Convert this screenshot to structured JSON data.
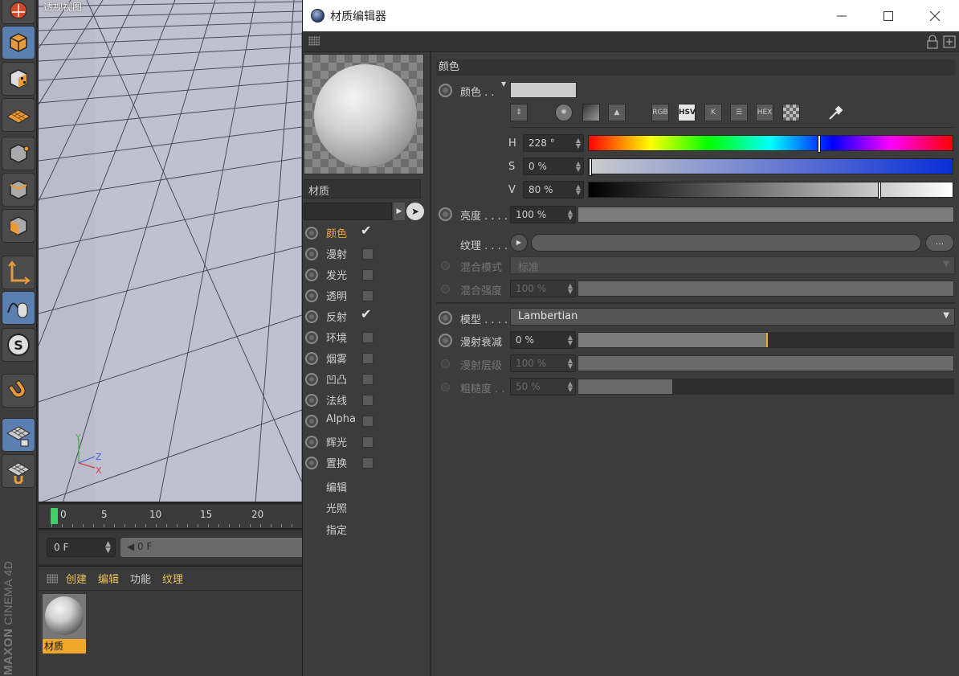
{
  "palette": {
    "tools": [
      "view-rotate-icon",
      "model-icon",
      "texture-icon",
      "workplane-icon",
      "points-icon",
      "edges-icon",
      "polygons-icon",
      "axis-icon",
      "tweak-icon",
      "soft-selection-icon",
      "snap-icon",
      "workplane-lock-icon",
      "workplane-snap-icon"
    ],
    "brand": "MAXON",
    "product": "CINEMA 4D",
    "accent": "#5b7fb0"
  },
  "viewport": {
    "title": "透视视图",
    "axes": [
      "Y",
      "Z",
      "X"
    ],
    "background_color": "#b9b8c8"
  },
  "timeline": {
    "ticks": [
      "0",
      "5",
      "10",
      "15",
      "20"
    ],
    "frame_field": "0 F",
    "slider_label": "◀ 0 F"
  },
  "material_manager": {
    "menu": [
      "创建",
      "编辑",
      "功能",
      "纹理"
    ],
    "materials": [
      {
        "name": "材质"
      }
    ],
    "selected_color": "#f0a82a"
  },
  "editor": {
    "title": "材质编辑器",
    "window_buttons": [
      "minimize",
      "maximize",
      "close"
    ],
    "material_name": "材质",
    "channels": [
      {
        "label": "颜色",
        "checked": true,
        "active": true
      },
      {
        "label": "漫射",
        "checked": false
      },
      {
        "label": "发光",
        "checked": false
      },
      {
        "label": "透明",
        "checked": false
      },
      {
        "label": "反射",
        "checked": true
      },
      {
        "label": "环境",
        "checked": false
      },
      {
        "label": "烟雾",
        "checked": false
      },
      {
        "label": "凹凸",
        "checked": false
      },
      {
        "label": "法线",
        "checked": false
      },
      {
        "label": "Alpha",
        "checked": false
      },
      {
        "label": "辉光",
        "checked": false
      },
      {
        "label": "置换",
        "checked": false
      }
    ],
    "extra_items": [
      "编辑",
      "光照",
      "指定"
    ],
    "section_title": "颜色",
    "color": {
      "label": "颜色 . .",
      "swatch_color": "#cccccc",
      "modes": [
        "RGB",
        "HSV",
        "K",
        "mixer",
        "HEX",
        "picture"
      ],
      "active_mode": "HSV",
      "H": {
        "label": "H",
        "value": "228 °",
        "fraction": 0.633
      },
      "S": {
        "label": "S",
        "value": "0 %",
        "fraction": 0.0
      },
      "V": {
        "label": "V",
        "value": "80 %",
        "fraction": 0.8
      }
    },
    "brightness": {
      "label": "亮度 . . . .",
      "value": "100 %",
      "fraction": 1.0
    },
    "texture": {
      "label": "纹理 . . . .",
      "more": "..."
    },
    "blend_mode": {
      "label": "混合模式",
      "value": "标准"
    },
    "blend_strength": {
      "label": "混合强度",
      "value": "100 %",
      "fraction": 1.0
    },
    "model": {
      "label": "模型 . . . .",
      "value": "Lambertian"
    },
    "diffuse_falloff": {
      "label": "漫射衰减",
      "value": "0 %",
      "fraction": 0.5
    },
    "diffuse_level": {
      "label": "漫射层级",
      "value": "100 %",
      "fraction": 1.0
    },
    "roughness": {
      "label": "粗糙度 . .",
      "value": "50 %",
      "fraction": 0.25
    }
  }
}
